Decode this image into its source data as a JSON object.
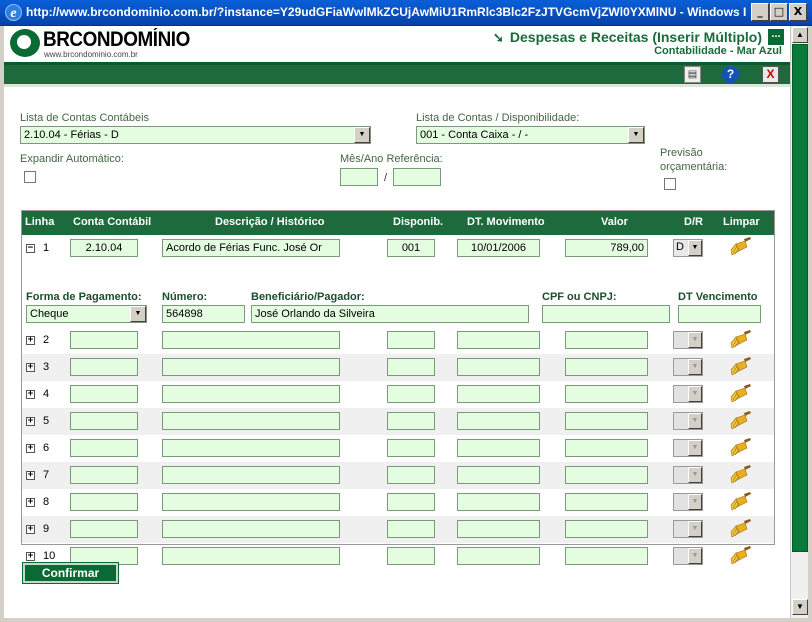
{
  "window": {
    "title": "http://www.brcondominio.com.br/?instance=Y29udGFiaWwlMkZCUjAwMiU1RmRlc3Blc2FzJTVGcmVjZWl0YXMlNU - Windows Inte...",
    "min_label": "_",
    "max_label": "□",
    "close_label": "X"
  },
  "brand": {
    "name": "BRCONDOMÍNIO",
    "url": "www.brcondominio.com.br"
  },
  "header": {
    "title": "Despesas e Receitas (Inserir Múltiplo)",
    "subtitle": "Contabilidade - Mar Azul",
    "menu_label": "..."
  },
  "toolbar": {
    "print_icon": "printer-icon",
    "help_label": "?",
    "close_label": "X"
  },
  "form": {
    "contas_contabeis_label": "Lista de Contas Contábeis",
    "contas_contabeis_value": "2.10.04 - Férias - D",
    "disponibilidade_label": "Lista de Contas / Disponibilidade:",
    "disponibilidade_value": "001 - Conta Caixa - / -",
    "expandir_label": "Expandir Automático:",
    "mes_ano_label": "Mês/Ano Referência:",
    "mes_value": "",
    "ano_value": "",
    "slash": "/",
    "previsao_label_1": "Previsão",
    "previsao_label_2": "orçamentária:"
  },
  "grid": {
    "headers": {
      "linha": "Linha",
      "conta": "Conta Contábil",
      "descricao": "Descrição / Histórico",
      "disponib": "Disponib.",
      "dt_movimento": "DT. Movimento",
      "valor": "Valor",
      "dr": "D/R",
      "limpar": "Limpar"
    },
    "first_row": {
      "num": "1",
      "conta": "2.10.04",
      "descricao": "Acordo de Férias Func. José Or",
      "disponib": "001",
      "dt_movimento": "10/01/2006",
      "valor": "789,00",
      "dr": "D"
    },
    "detail": {
      "forma_label": "Forma de Pagamento:",
      "forma_value": "Cheque",
      "numero_label": "Número:",
      "numero_value": "564898",
      "beneficiario_label": "Beneficiário/Pagador:",
      "beneficiario_value": "José Orlando da Silveira",
      "cpf_label": "CPF ou CNPJ:",
      "cpf_value": "",
      "dt_venc_label": "DT Vencimento",
      "dt_venc_value": ""
    },
    "rows": [
      "2",
      "3",
      "4",
      "5",
      "6",
      "7",
      "8",
      "9",
      "10"
    ]
  },
  "confirm_label": "Confirmar"
}
